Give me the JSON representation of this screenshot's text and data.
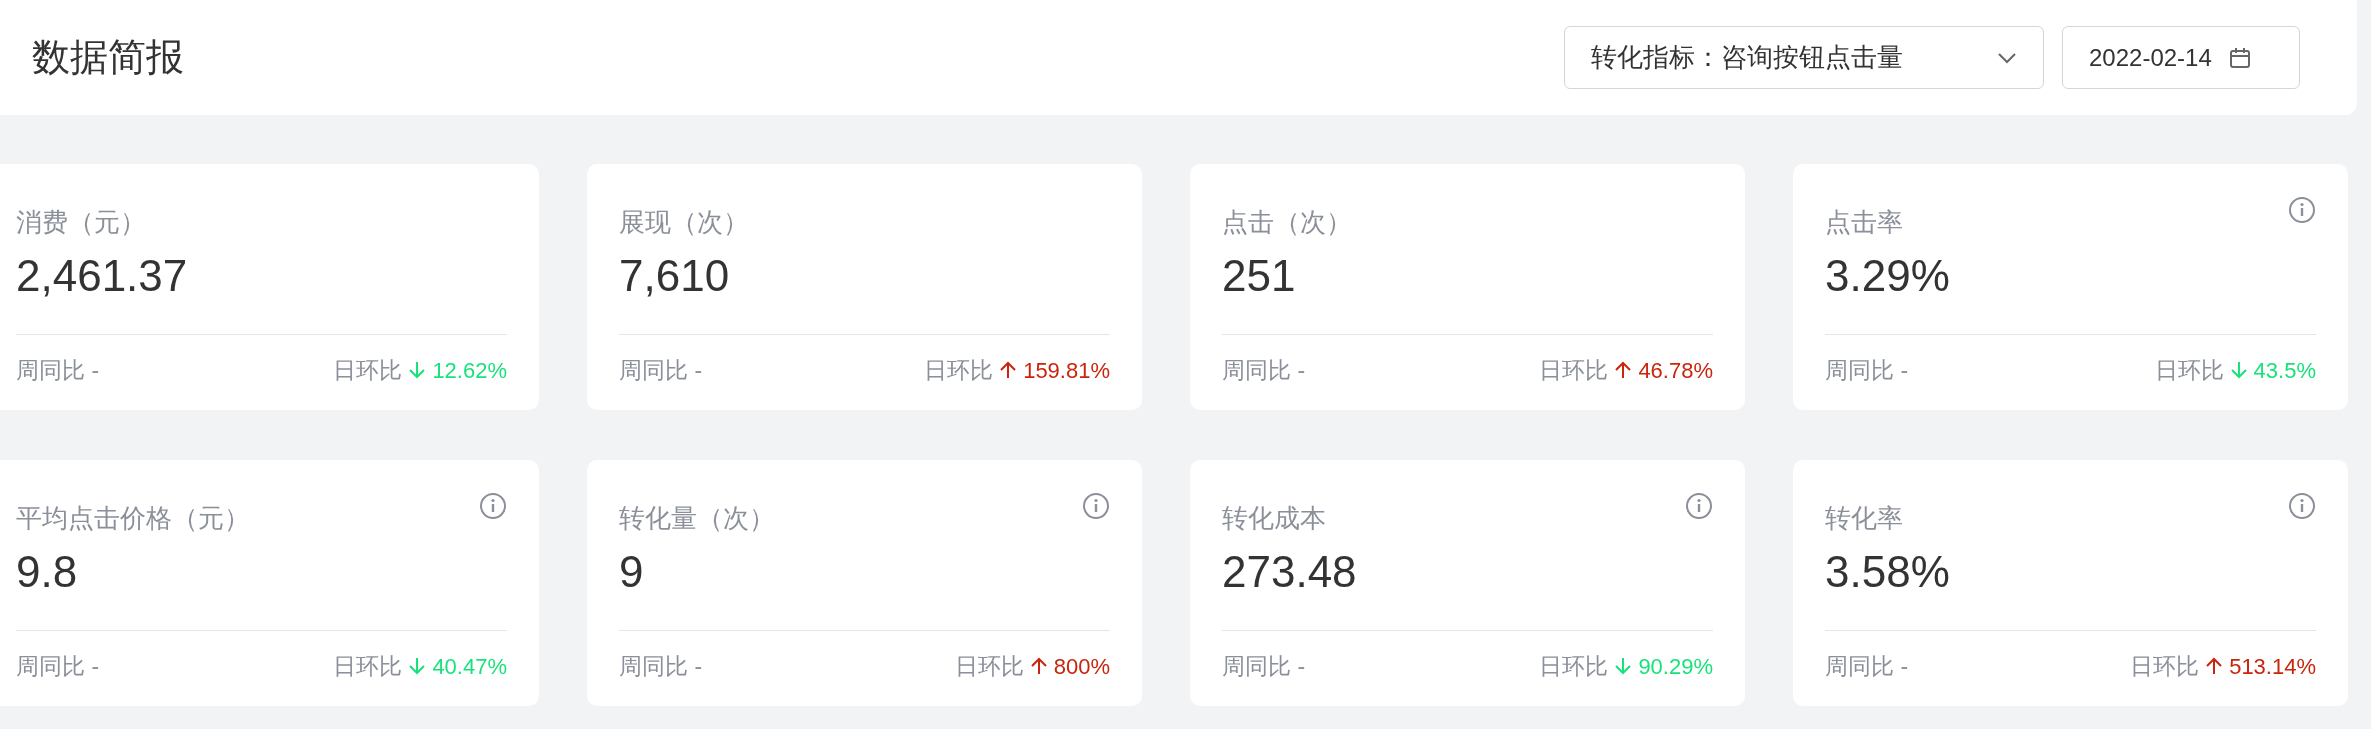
{
  "header": {
    "title": "数据简报",
    "metric_select": {
      "value": "转化指标：咨询按钮点击量"
    },
    "date_field": {
      "value": "2022-02-14"
    }
  },
  "cards": [
    {
      "label": "消费（元）",
      "value": "2,461.37",
      "info": false,
      "week_label": "周同比 -",
      "day_label": "日环比",
      "kind": "down",
      "change": "12.62%"
    },
    {
      "label": "展现（次）",
      "value": "7,610",
      "info": false,
      "week_label": "周同比 -",
      "day_label": "日环比",
      "kind": "up",
      "change": "159.81%"
    },
    {
      "label": "点击（次）",
      "value": "251",
      "info": false,
      "week_label": "周同比 -",
      "day_label": "日环比",
      "kind": "up",
      "change": "46.78%"
    },
    {
      "label": "点击率",
      "value": "3.29%",
      "info": true,
      "week_label": "周同比 -",
      "day_label": "日环比",
      "kind": "down",
      "change": "43.5%"
    },
    {
      "label": "平均点击价格（元）",
      "value": "9.8",
      "info": true,
      "week_label": "周同比 -",
      "day_label": "日环比",
      "kind": "down",
      "change": "40.47%"
    },
    {
      "label": "转化量（次）",
      "value": "9",
      "info": true,
      "week_label": "周同比 -",
      "day_label": "日环比",
      "kind": "up",
      "change": "800%"
    },
    {
      "label": "转化成本",
      "value": "273.48",
      "info": true,
      "week_label": "周同比 -",
      "day_label": "日环比",
      "kind": "down",
      "change": "90.29%"
    },
    {
      "label": "转化率",
      "value": "3.58%",
      "info": true,
      "week_label": "周同比 -",
      "day_label": "日环比",
      "kind": "up",
      "change": "513.14%"
    }
  ]
}
